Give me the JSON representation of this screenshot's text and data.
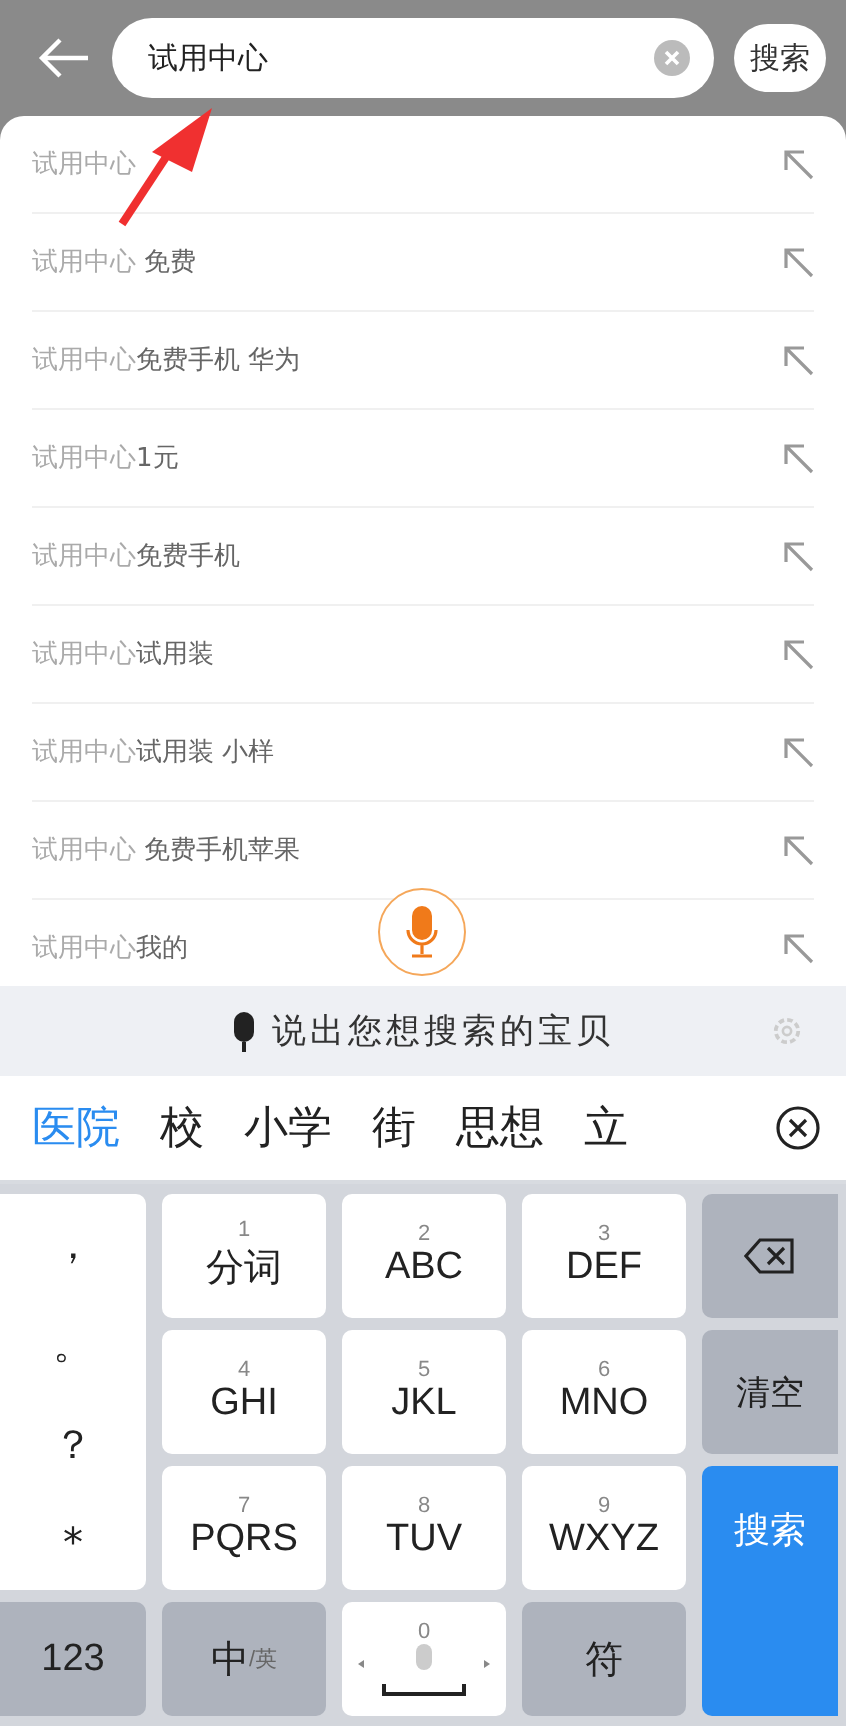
{
  "search_bar": {
    "value": "试用中心",
    "search_button": "搜索"
  },
  "suggestions": [
    {
      "match": "试用中心"
    },
    {
      "match": "试用中心",
      "completion": " 免费"
    },
    {
      "match": "试用中心",
      "completion": "免费手机 华为"
    },
    {
      "match": "试用中心",
      "completion": "1元"
    },
    {
      "match": "试用中心",
      "completion": "免费手机"
    },
    {
      "match": "试用中心",
      "completion": "试用装"
    },
    {
      "match": "试用中心",
      "completion": "试用装 小样"
    },
    {
      "match": "试用中心",
      "completion": " 免费手机苹果"
    },
    {
      "match": "试用中心",
      "completion": "我的"
    }
  ],
  "voice_hint": "说出您想搜索的宝贝",
  "candidates": [
    {
      "text": "医院",
      "selected": true
    },
    {
      "text": "校",
      "selected": false
    },
    {
      "text": "小学",
      "selected": false
    },
    {
      "text": "街",
      "selected": false
    },
    {
      "text": "思想",
      "selected": false
    },
    {
      "text": "立",
      "selected": false
    }
  ],
  "keyboard": {
    "punctuation": [
      "，",
      "。",
      "？",
      "*"
    ],
    "keys": [
      {
        "digit": "1",
        "label": "分词"
      },
      {
        "digit": "2",
        "label": "ABC"
      },
      {
        "digit": "3",
        "label": "DEF"
      },
      {
        "digit": "4",
        "label": "GHI"
      },
      {
        "digit": "5",
        "label": "JKL"
      },
      {
        "digit": "6",
        "label": "MNO"
      },
      {
        "digit": "7",
        "label": "PQRS"
      },
      {
        "digit": "8",
        "label": "TUV"
      },
      {
        "digit": "9",
        "label": "WXYZ"
      }
    ],
    "clear": "清空",
    "search": "搜索",
    "numbers": "123",
    "lang_main": "中",
    "lang_alt": "/英",
    "space_digit": "0",
    "symbols": "符"
  }
}
